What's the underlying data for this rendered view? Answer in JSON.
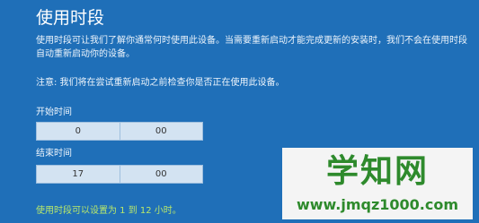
{
  "header": {
    "title": "使用时段"
  },
  "main": {
    "description": "使用时段可让我们了解你通常何时使用此设备。当需要重新启动才能完成更新的安装时，我们不会在使用时段自动重新启动你的设备。",
    "note": "注意: 我们将在尝试重新启动之前检查你是否正在使用此设备。",
    "start": {
      "label": "开始时间",
      "hour": "0",
      "minute": "00"
    },
    "end": {
      "label": "结束时间",
      "hour": "17",
      "minute": "00"
    },
    "footer": "使用时段可以设置为 1 到 12 小时。"
  },
  "watermark": {
    "title": "学知网",
    "url": "www.jmqz1000.com"
  },
  "colors": {
    "background": "#1f6fb8",
    "field": "#d3e3f2",
    "footer_text": "#b9e86a",
    "watermark_text": "#2e8a2c"
  }
}
